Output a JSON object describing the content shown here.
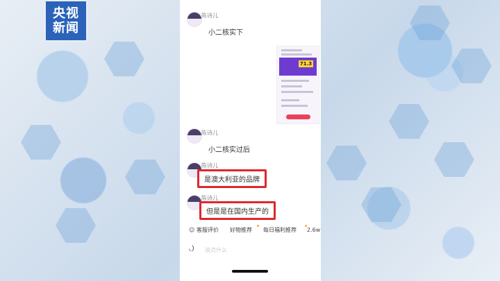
{
  "logo": {
    "line1": "央视",
    "line2": "新闻"
  },
  "chat": {
    "messages": [
      {
        "sender": "陈诗儿",
        "text": "小二核实下"
      },
      {
        "sender": "陈诗儿",
        "text": "小二核实过后"
      },
      {
        "sender": "陈诗儿",
        "text": "是澳大利亚的品牌",
        "highlighted": true
      },
      {
        "sender": "陈诗儿",
        "text": "但是是在国内生产的",
        "highlighted": true
      }
    ],
    "screenshot": {
      "price": "71.3"
    }
  },
  "quick_replies": {
    "items": [
      "客服评价",
      "好物推荐",
      "每日福利推荐",
      "2.6w"
    ]
  },
  "input": {
    "placeholder": "说点什么"
  },
  "colors": {
    "highlight_border": "#e0262d",
    "logo_bg": "#2a63b8",
    "brand_purple": "#6e3bd0"
  }
}
